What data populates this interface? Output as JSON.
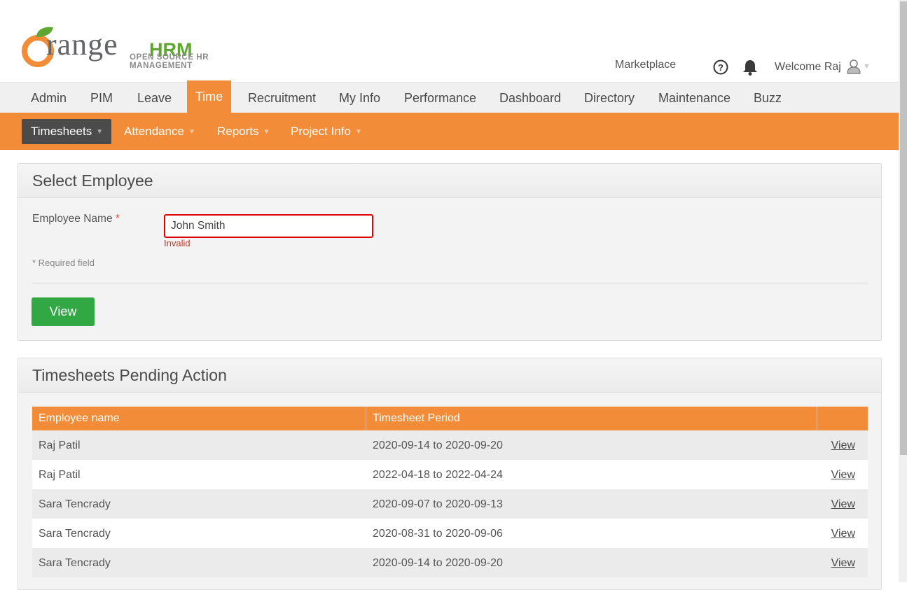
{
  "logo": {
    "word": "range",
    "hrm": "HRM",
    "tagline": "OPEN SOURCE HR MANAGEMENT",
    "brand_orange": "#f28c38",
    "brand_green": "#5fa532"
  },
  "header": {
    "marketplace": "Marketplace",
    "welcome": "Welcome Raj"
  },
  "main_nav": [
    "Admin",
    "PIM",
    "Leave",
    "Time",
    "Recruitment",
    "My Info",
    "Performance",
    "Dashboard",
    "Directory",
    "Maintenance",
    "Buzz"
  ],
  "main_nav_active": "Time",
  "sub_nav": [
    "Timesheets",
    "Attendance",
    "Reports",
    "Project Info"
  ],
  "select_employee": {
    "title": "Select Employee",
    "label": "Employee Name",
    "required_mark": "*",
    "value": "John Smith",
    "error": "Invalid",
    "required_note": "* Required field",
    "button": "View"
  },
  "pending": {
    "title": "Timesheets Pending Action",
    "columns": [
      "Employee name",
      "Timesheet Period",
      ""
    ],
    "rows": [
      {
        "name": "Raj Patil",
        "period": "2020-09-14 to 2020-09-20",
        "action": "View"
      },
      {
        "name": "Raj Patil",
        "period": "2022-04-18 to 2022-04-24",
        "action": "View"
      },
      {
        "name": "Sara Tencrady",
        "period": "2020-09-07 to 2020-09-13",
        "action": "View"
      },
      {
        "name": "Sara Tencrady",
        "period": "2020-08-31 to 2020-09-06",
        "action": "View"
      },
      {
        "name": "Sara Tencrady",
        "period": "2020-09-14 to 2020-09-20",
        "action": "View"
      }
    ]
  },
  "colors": {
    "accent": "#f28c38",
    "button_green": "#32a844",
    "error_red": "#e00000",
    "subnav_active": "#4b4b4b"
  }
}
